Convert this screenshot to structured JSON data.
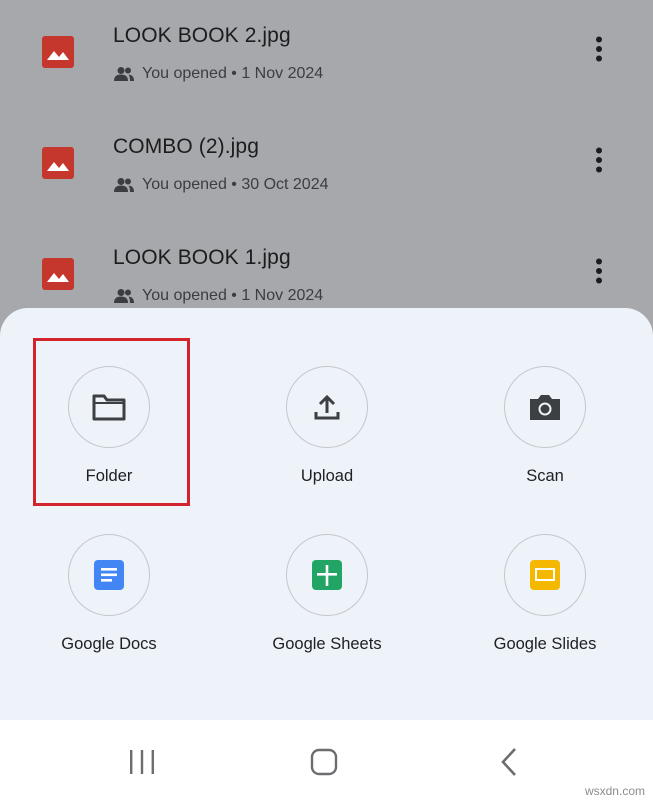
{
  "files": [
    {
      "name": "LOOK BOOK 2.jpg",
      "meta": "You opened • 1 Nov 2024"
    },
    {
      "name": "COMBO (2).jpg",
      "meta": "You opened • 30 Oct 2024"
    },
    {
      "name": "LOOK BOOK 1.jpg",
      "meta": "You opened • 1 Nov 2024"
    }
  ],
  "create_menu": {
    "folder_label": "Folder",
    "upload_label": "Upload",
    "scan_label": "Scan",
    "docs_label": "Google Docs",
    "sheets_label": "Google Sheets",
    "slides_label": "Google Slides"
  },
  "colors": {
    "image_file_icon": "#c5362c",
    "docs_blue": "#4285f4",
    "sheets_green": "#21a464",
    "slides_yellow": "#f5b800",
    "highlight_red": "#d3242d"
  },
  "watermark": "wsxdn.com"
}
